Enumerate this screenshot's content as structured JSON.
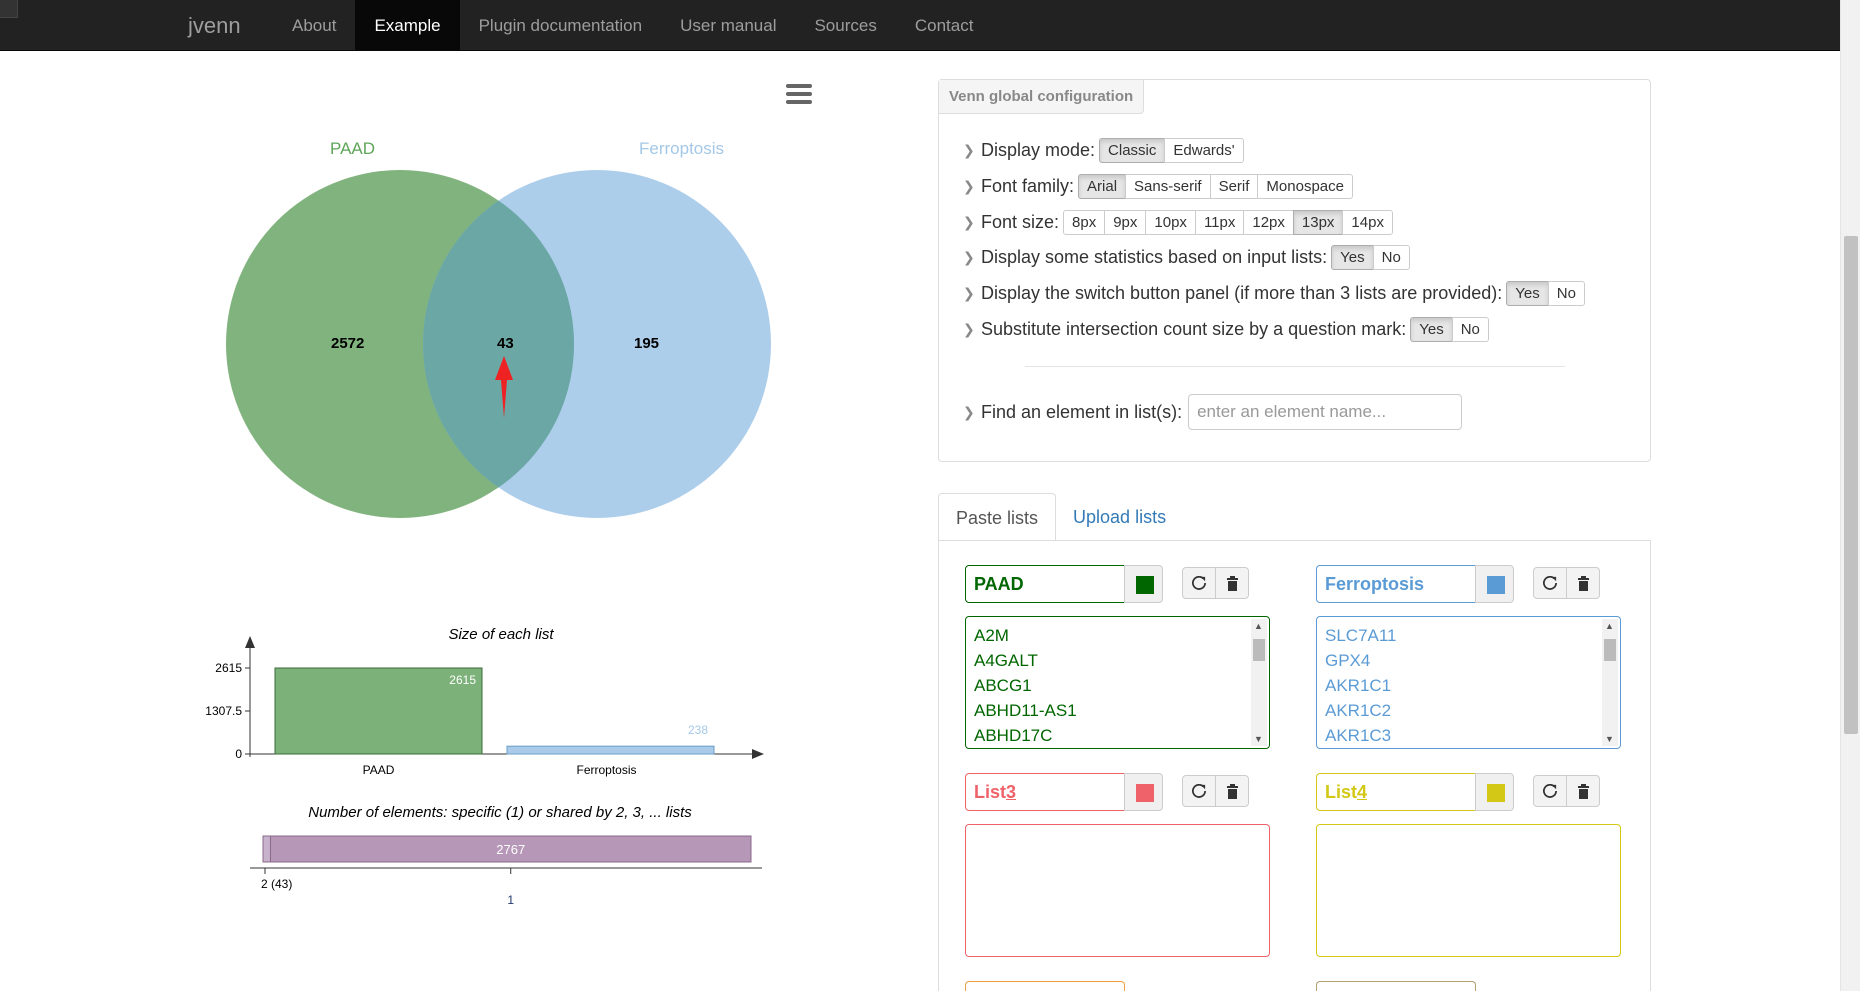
{
  "navbar": {
    "brand": "jvenn",
    "items": [
      {
        "label": "About"
      },
      {
        "label": "Example",
        "active": true
      },
      {
        "label": "Plugin documentation"
      },
      {
        "label": "User manual"
      },
      {
        "label": "Sources"
      },
      {
        "label": "Contact"
      }
    ],
    "bg_color": "#222222"
  },
  "venn": {
    "lists": [
      {
        "name": "PAAD",
        "color": "#006600",
        "label_color": "#5fa55a",
        "fill": "#5c9e58"
      },
      {
        "name": "Ferroptosis",
        "color": "#5b9bd5",
        "label_color": "#a4c8e8",
        "fill": "#9fc6e8"
      }
    ],
    "counts": {
      "paad_only": "2572",
      "shared": "43",
      "ferroptosis_only": "195"
    },
    "menu_icon": "hamburger-icon",
    "arrow_icon": "red-arrow-icon"
  },
  "chart_data": [
    {
      "type": "bar",
      "title": "Size of each list",
      "categories": [
        "PAAD",
        "Ferroptosis"
      ],
      "values": [
        2615,
        238
      ],
      "ylim": [
        0,
        2615
      ],
      "yticks": [
        "0",
        "1307.5",
        "2615"
      ],
      "value_labels": [
        "2615",
        "238"
      ],
      "colors": [
        "#7db17a",
        "#a9cbe9"
      ]
    },
    {
      "type": "bar",
      "title": "Number of elements: specific (1) or shared by 2, 3, ... lists",
      "categories": [
        "2",
        "1"
      ],
      "values": [
        43,
        2767
      ],
      "value_labels": [
        "",
        "2767"
      ],
      "tick_labels": [
        "2 (43)",
        "1"
      ],
      "colors": [
        "#c8b3cc",
        "#b797b7"
      ]
    }
  ],
  "config": {
    "title": "Venn global configuration",
    "options": [
      {
        "label": "Display mode:",
        "buttons": [
          "Classic",
          "Edwards'"
        ],
        "selected": "Classic"
      },
      {
        "label": "Font family:",
        "buttons": [
          "Arial",
          "Sans-serif",
          "Serif",
          "Monospace"
        ],
        "selected": "Arial"
      },
      {
        "label": "Font size:",
        "buttons": [
          "8px",
          "9px",
          "10px",
          "11px",
          "12px",
          "13px",
          "14px"
        ],
        "selected": "13px"
      },
      {
        "label": "Display some statistics based on input lists:",
        "buttons": [
          "Yes",
          "No"
        ],
        "selected": "Yes"
      },
      {
        "label": "Display the switch button panel (if more than 3 lists are provided):",
        "buttons": [
          "Yes",
          "No"
        ],
        "selected": "Yes"
      },
      {
        "label": "Substitute intersection count size by a question mark:",
        "buttons": [
          "Yes",
          "No"
        ],
        "selected": "Yes"
      }
    ],
    "find_label": "Find an element in list(s):",
    "find_placeholder": "enter an element name..."
  },
  "tabs": [
    {
      "label": "Paste lists",
      "active": true
    },
    {
      "label": "Upload lists"
    }
  ],
  "lists": [
    {
      "name": "PAAD",
      "color": "#006600",
      "items": [
        "A2M",
        "A4GALT",
        "ABCG1",
        "ABHD11-AS1",
        "ABHD17C"
      ]
    },
    {
      "name": "Ferroptosis",
      "color": "#5b9bd5",
      "items": [
        "SLC7A11",
        "GPX4",
        "AKR1C1",
        "AKR1C2",
        "AKR1C3"
      ]
    },
    {
      "name_prefix": "List ",
      "name_num": "3",
      "color": "#f0626a",
      "items": []
    },
    {
      "name_prefix": "List ",
      "name_num": "4",
      "color": "#d4c816",
      "items": []
    }
  ]
}
